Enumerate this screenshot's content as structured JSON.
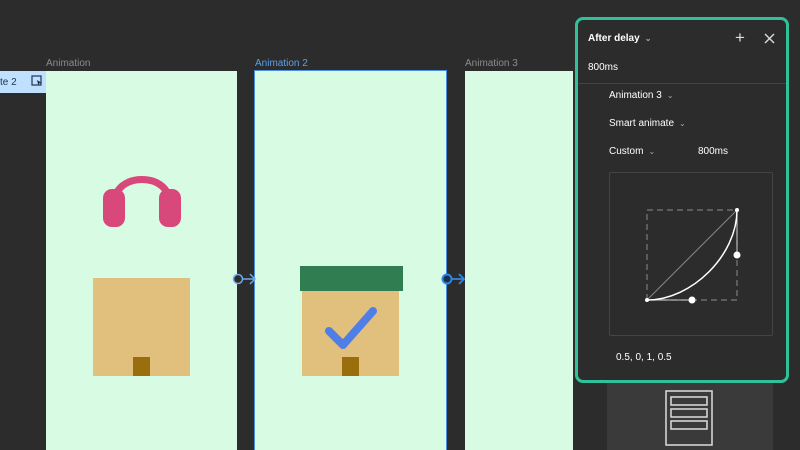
{
  "flow": {
    "start_tag": "te 2"
  },
  "frames": [
    {
      "label": "Animation"
    },
    {
      "label": "Animation 2"
    },
    {
      "label": "Animation 3"
    }
  ],
  "panel": {
    "trigger": "After delay",
    "delay": "800ms",
    "destination": "Animation 3",
    "animation": "Smart animate",
    "easing": "Custom",
    "duration": "800ms",
    "bezier": "0.5, 0, 1, 0.5"
  },
  "colors": {
    "accent": "#2fc29a",
    "frame_bg": "#d7fbe3",
    "headphones": "#d9487a",
    "box": "#e0c07c",
    "box_lid": "#2f7d50",
    "check": "#4f7fe6",
    "selection": "#4a8fe0"
  }
}
